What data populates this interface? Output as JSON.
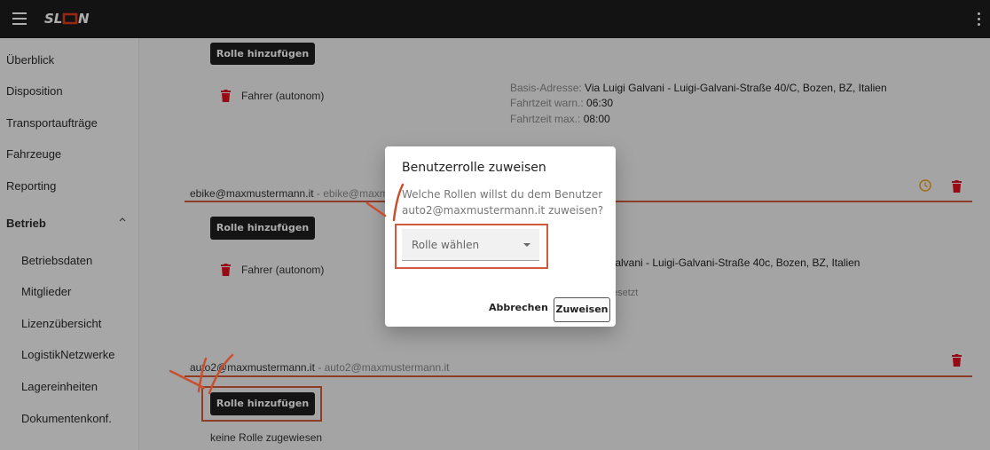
{
  "app": {
    "logo_text": "SLON"
  },
  "sidebar": {
    "items": [
      {
        "label": "Überblick"
      },
      {
        "label": "Disposition"
      },
      {
        "label": "Transportaufträge"
      },
      {
        "label": "Fahrzeuge"
      },
      {
        "label": "Reporting"
      },
      {
        "label": "Betrieb"
      },
      {
        "label": "Betriebsdaten"
      },
      {
        "label": "Mitglieder"
      },
      {
        "label": "Lizenzübersicht"
      },
      {
        "label": "LogistikNetzwerke"
      },
      {
        "label": "Lagereinheiten"
      },
      {
        "label": "Dokumentenkonf."
      }
    ]
  },
  "users": [
    {
      "add_role_label": "Rolle hinzufügen",
      "role": "Fahrer (autonom)",
      "details": [
        {
          "label": "Basis-Adresse: ",
          "value": "Via Luigi Galvani - Luigi-Galvani-Straße 40/C, Bozen, BZ, Italien"
        },
        {
          "label": "Fahrtzeit warn.: ",
          "value": "06:30"
        },
        {
          "label": "Fahrtzeit max.: ",
          "value": "08:00"
        }
      ]
    },
    {
      "email": "ebike@maxmustermann.it",
      "email_secondary": " - ebike@maxm",
      "add_role_label": "Rolle hinzufügen",
      "role": "Fahrer (autonom)",
      "detail_partial": "i Galvani - Luigi-Galvani-Straße 40c, Bozen, BZ, Italien",
      "detail_partial_2": "esetzt"
    },
    {
      "email": "auto2@maxmustermann.it",
      "email_secondary": " - auto2@maxmustermann.it",
      "add_role_label": "Rolle hinzufügen",
      "no_role_text": "keine Rolle zugewiesen"
    }
  ],
  "dialog": {
    "title": "Benutzerrolle zuweisen",
    "text": "Welche Rollen willst du dem Benutzer auto2@maxmustermann.it zuweisen?",
    "select_placeholder": "Rolle wählen",
    "cancel_label": "Abbrechen",
    "assign_label": "Zuweisen"
  },
  "colors": {
    "accent": "#d25a3c",
    "trash": "#e0101f",
    "clock": "#f0a020",
    "topbar": "#1d1d1d"
  }
}
